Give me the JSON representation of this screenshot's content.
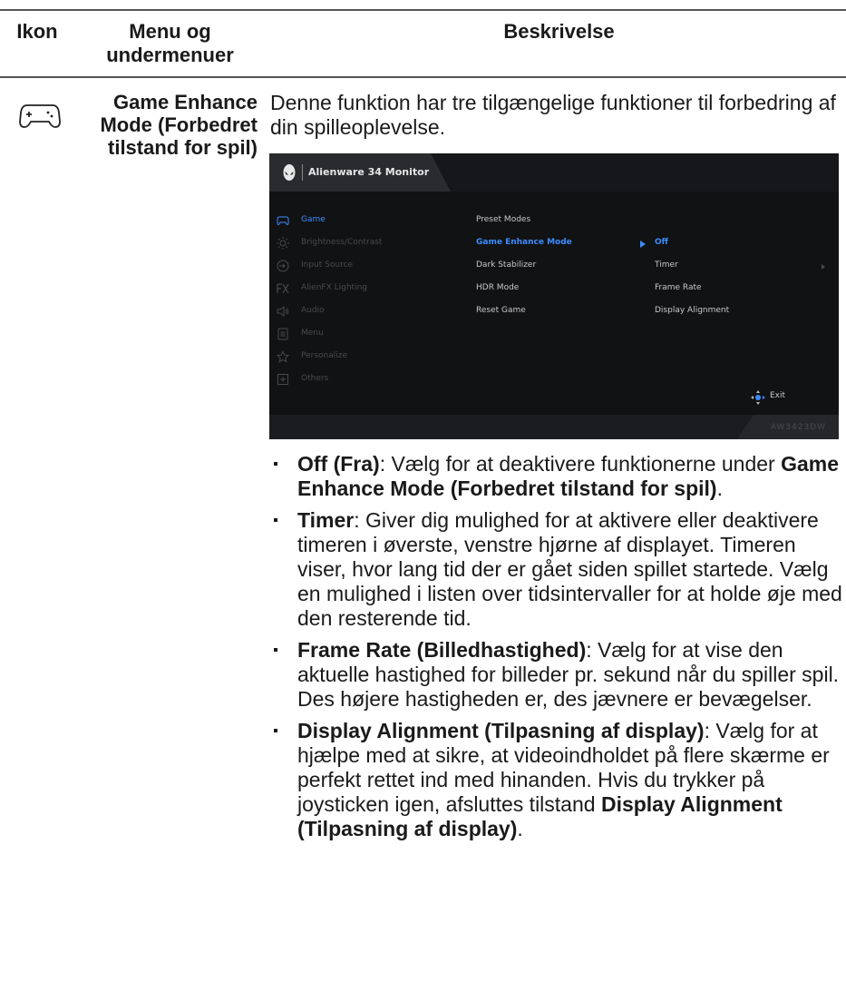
{
  "table": {
    "headers": {
      "icon": "Ikon",
      "menu": "Menu og undermenuer",
      "description": "Beskrivelse"
    },
    "row": {
      "icon": "gamepad-icon",
      "title": "Game Enhance Mode (Forbedret tilstand for spil)",
      "intro": "Denne funktion har tre tilgængelige funktioner til forbedring af din spilleoplevelse."
    }
  },
  "osd": {
    "header_title": "Alienware 34 Monitor",
    "menu_items": [
      {
        "icon": "gamepad-icon",
        "label": "Game",
        "active": true
      },
      {
        "icon": "brightness-icon",
        "label": "Brightness/Contrast",
        "active": false
      },
      {
        "icon": "input-icon",
        "label": "Input Source",
        "active": false
      },
      {
        "icon": "fx-icon",
        "label": "AlienFX Lighting",
        "active": false
      },
      {
        "icon": "speaker-icon",
        "label": "Audio",
        "active": false
      },
      {
        "icon": "menu-icon",
        "label": "Menu",
        "active": false
      },
      {
        "icon": "star-icon",
        "label": "Personalize",
        "active": false
      },
      {
        "icon": "others-icon",
        "label": "Others",
        "active": false
      }
    ],
    "submenu": [
      {
        "label": "Preset Modes",
        "selected": false
      },
      {
        "label": "Game Enhance Mode",
        "selected": true
      },
      {
        "label": "Dark Stabilizer",
        "selected": false
      },
      {
        "label": "HDR Mode",
        "selected": false
      },
      {
        "label": "Reset Game",
        "selected": false
      }
    ],
    "options": [
      {
        "label": "Off",
        "selected": true
      },
      {
        "label": "Timer",
        "selected": false
      },
      {
        "label": "Frame Rate",
        "selected": false
      },
      {
        "label": "Display Alignment",
        "selected": false
      }
    ],
    "exit_label": "Exit",
    "model": "AW3423DW",
    "colors": {
      "accent": "#3d8cff",
      "background": "#111214"
    }
  },
  "bullets": [
    {
      "parts": [
        {
          "b": true,
          "t": "Off (Fra)"
        },
        {
          "b": false,
          "t": ": Vælg for at deaktivere funktionerne under "
        },
        {
          "b": true,
          "t": "Game Enhance Mode (Forbedret tilstand for spil)"
        },
        {
          "b": false,
          "t": "."
        }
      ]
    },
    {
      "parts": [
        {
          "b": true,
          "t": "Timer"
        },
        {
          "b": false,
          "t": ": Giver dig mulighed for at aktivere eller deaktivere timeren i øverste, venstre hjørne af displayet. Timeren viser, hvor lang tid der er gået siden spillet startede. Vælg en mulighed i listen over tidsintervaller for at holde øje med den resterende tid."
        }
      ]
    },
    {
      "parts": [
        {
          "b": true,
          "t": "Frame Rate (Billedhastighed)"
        },
        {
          "b": false,
          "t": ": Vælg for at vise den aktuelle hastighed for billeder pr. sekund når du spiller spil. Des højere hastigheden er, des jævnere er bevægelser."
        }
      ]
    },
    {
      "parts": [
        {
          "b": true,
          "t": "Display Alignment (Tilpasning af display)"
        },
        {
          "b": false,
          "t": ": Vælg for at hjælpe med at sikre, at videoindholdet på flere skærme er perfekt rettet ind med hinanden. Hvis du trykker på joysticken igen, afsluttes tilstand "
        },
        {
          "b": true,
          "t": "Display Alignment (Tilpasning af display)"
        },
        {
          "b": false,
          "t": "."
        }
      ]
    }
  ]
}
